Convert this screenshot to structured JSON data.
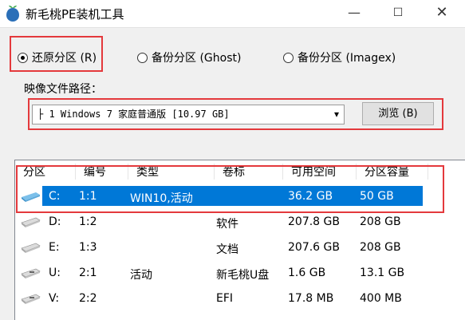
{
  "window": {
    "title": "新毛桃PE装机工具",
    "min_glyph": "—",
    "max_glyph": "☐",
    "close_glyph": "✕"
  },
  "modes": [
    {
      "label": "还原分区 (R)",
      "checked": true
    },
    {
      "label": "备份分区 (Ghost)",
      "checked": false
    },
    {
      "label": "备份分区 (Imagex)",
      "checked": false
    }
  ],
  "image_path": {
    "label": "映像文件路径：",
    "value": "├ 1 Windows 7 家庭普通版 [10.97 GB]",
    "browse_label": "浏览 (B)"
  },
  "table": {
    "columns": [
      "分区",
      "编号",
      "类型",
      "卷标",
      "可用空间",
      "分区容量"
    ],
    "rows": [
      {
        "drive": "C:",
        "num": "1:1",
        "type": "WIN10,活动",
        "label": "",
        "free": "36.2 GB",
        "size": "50 GB",
        "selected": true
      },
      {
        "drive": "D:",
        "num": "1:2",
        "type": "",
        "label": "软件",
        "free": "207.8 GB",
        "size": "208 GB",
        "selected": false
      },
      {
        "drive": "E:",
        "num": "1:3",
        "type": "",
        "label": "文档",
        "free": "207.6 GB",
        "size": "208 GB",
        "selected": false
      },
      {
        "drive": "U:",
        "num": "2:1",
        "type": "活动",
        "label": "新毛桃U盘",
        "free": "1.6 GB",
        "size": "13.1 GB",
        "selected": false
      },
      {
        "drive": "V:",
        "num": "2:2",
        "type": "",
        "label": "EFI",
        "free": "17.8 MB",
        "size": "400 MB",
        "selected": false
      }
    ]
  },
  "colors": {
    "accent": "#0078d7",
    "highlight_box": "#e4393c"
  }
}
